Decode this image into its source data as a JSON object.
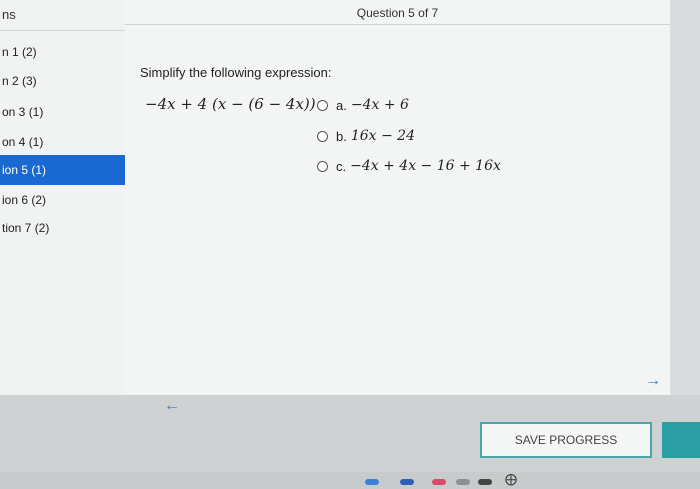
{
  "left_panel": {
    "header": "ns",
    "items": [
      {
        "label": "n 1  (2)"
      },
      {
        "label": "n 2  (3)"
      },
      {
        "label": "on 3  (1)"
      },
      {
        "label": "on 4  (1)"
      },
      {
        "label": "ion 5  (1)",
        "active": true
      },
      {
        "label": "ion 6  (2)"
      },
      {
        "label": "tion 7  (2)"
      }
    ]
  },
  "main": {
    "header": "Question 5 of 7",
    "prompt": "Simplify the following expression:",
    "expression": "−4x + 4 (x − (6 − 4x))",
    "options": [
      {
        "letter": "a.",
        "math": "−4x + 6"
      },
      {
        "letter": "b.",
        "math": "16x − 24"
      },
      {
        "letter": "c.",
        "math": "−4x + 4x − 16 + 16x"
      }
    ]
  },
  "nav": {
    "next_icon": "arrow-right-icon",
    "prev_icon": "arrow-left-icon"
  },
  "footer": {
    "save_label": "SAVE PROGRESS"
  },
  "colors": {
    "active_item": "#1a68d1",
    "save_border": "#4aa6a8",
    "teal_button": "#2a9ea2",
    "arrow": "#2f78d6"
  }
}
